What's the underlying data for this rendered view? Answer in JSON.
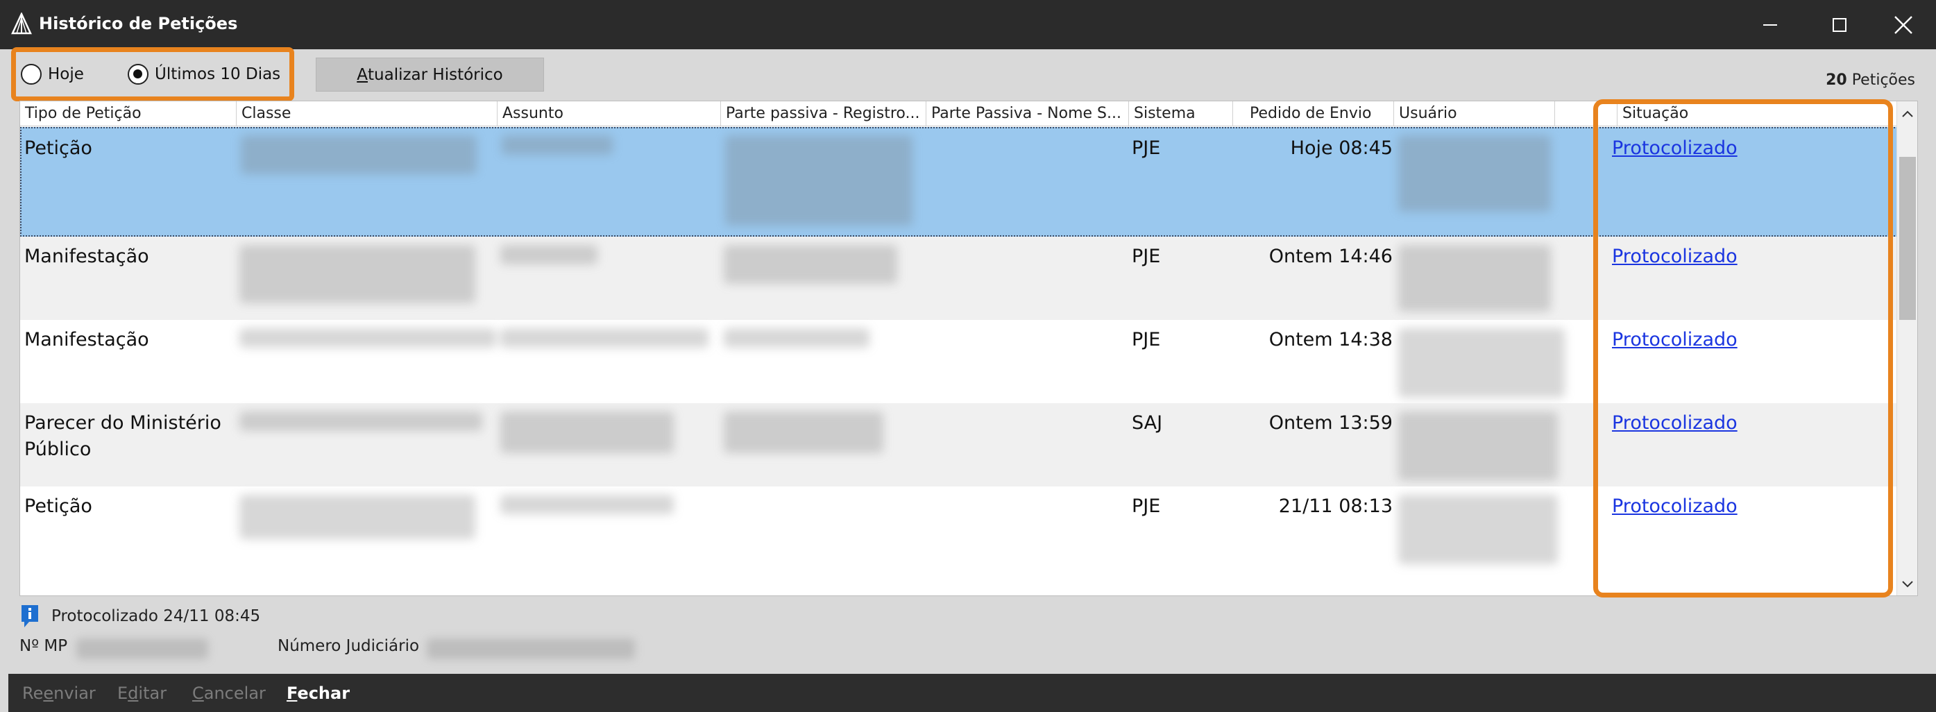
{
  "window": {
    "title": "Histórico de Petições"
  },
  "toolbar": {
    "period_today": "Hoje",
    "period_last10": "Últimos 10 Dias",
    "selected_period": "Últimos 10 Dias",
    "refresh_button_lead": "A",
    "refresh_button_rest": "tualizar Histórico",
    "count_number": "20",
    "count_label": "Petições"
  },
  "grid": {
    "columns": [
      "Tipo de Petição",
      "Classe",
      "Assunto",
      "Parte passiva - Registro...",
      "Parte Passiva - Nome S...",
      "Sistema",
      "Pedido de Envio",
      "Usuário",
      "",
      "Situação"
    ],
    "rows": [
      {
        "tipo": "Petição",
        "sistema": "PJE",
        "pedido": "Hoje 08:45",
        "situacao": "Protocolizado"
      },
      {
        "tipo": "Manifestação",
        "sistema": "PJE",
        "pedido": "Ontem 14:46",
        "situacao": "Protocolizado"
      },
      {
        "tipo": "Manifestação",
        "sistema": "PJE",
        "pedido": "Ontem 14:38",
        "situacao": "Protocolizado"
      },
      {
        "tipo": "Parecer do Ministério Público",
        "sistema": "SAJ",
        "pedido": "Ontem 13:59",
        "situacao": "Protocolizado"
      },
      {
        "tipo": "Petição",
        "sistema": "PJE",
        "pedido": "21/11 08:13",
        "situacao": "Protocolizado"
      }
    ]
  },
  "status": {
    "message": "Protocolizado 24/11 08:45",
    "mp_label": "Nº MP",
    "judicial_label": "Número Judiciário"
  },
  "footer": {
    "resend_lead": "Re",
    "resend_key": "e",
    "resend_rest": "nviar",
    "edit_lead": "E",
    "edit_key": "d",
    "edit_rest": "itar",
    "cancel_key": "C",
    "cancel_rest": "ancelar",
    "close_key": "F",
    "close_rest": "echar"
  },
  "colors": {
    "highlight": "#e8831e",
    "selected_row": "#9ac8ee",
    "link": "#1a35e0",
    "titlebar": "#2b2b2b"
  }
}
